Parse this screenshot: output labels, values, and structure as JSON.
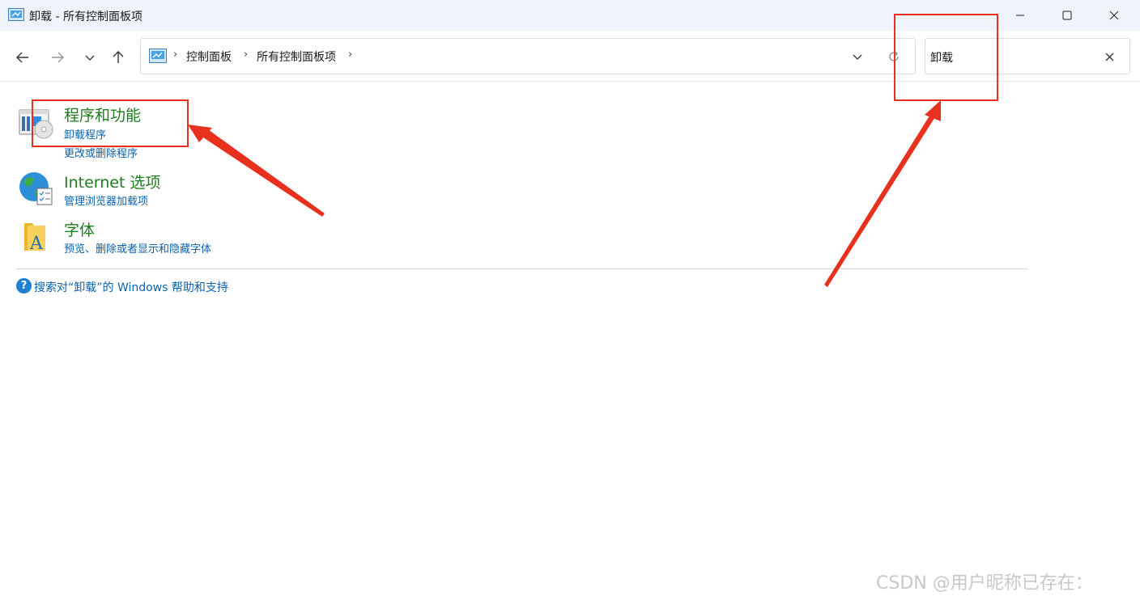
{
  "window": {
    "title": "卸载 - 所有控制面板项",
    "icon": "control-panel-icon",
    "buttons": [
      "minimize-icon",
      "maximize-icon",
      "close-icon"
    ]
  },
  "navigation": {
    "back": "back-arrow-icon",
    "forward": "forward-arrow-icon",
    "recent": "chevron-down-icon",
    "up": "up-arrow-icon"
  },
  "address": {
    "icon": "control-panel-icon",
    "separator": "›",
    "crumbs": [
      "控制面板",
      "所有控制面板项"
    ]
  },
  "search": {
    "value": "卸载",
    "clear_icon": "close-icon"
  },
  "results": [
    {
      "title": "程序和功能",
      "icon": "programs-features-icon",
      "links": [
        "卸载程序",
        "更改或删除程序"
      ]
    },
    {
      "title": "Internet 选项",
      "icon": "internet-options-icon",
      "links": [
        "管理浏览器加载项"
      ]
    },
    {
      "title": "字体",
      "icon": "fonts-folder-icon",
      "links": [
        "预览、删除或者显示和隐藏字体"
      ]
    }
  ],
  "help": {
    "icon_char": "?",
    "text": "搜索对“卸载”的 Windows 帮助和支持"
  },
  "watermark": "CSDN @用户昵称已存在：",
  "colors": {
    "annotation": "#e8301e",
    "heading": "#1e7d1e",
    "link": "#0a62b0",
    "titlebar": "#eef4f9"
  }
}
